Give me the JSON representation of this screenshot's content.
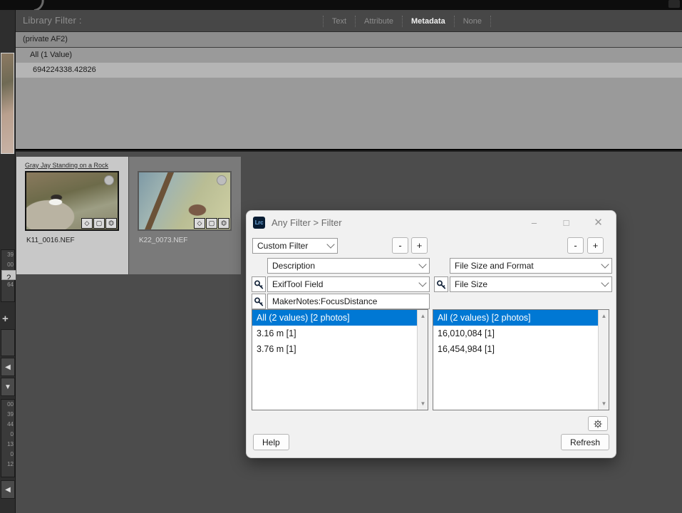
{
  "app": {
    "filter_bar": {
      "title": "Library Filter :",
      "tabs": [
        {
          "label": "Text",
          "active": false
        },
        {
          "label": "Attribute",
          "active": false
        },
        {
          "label": "Metadata",
          "active": true
        },
        {
          "label": "None",
          "active": false
        }
      ]
    },
    "metadata_panel": {
      "column_header": "(private AF2)",
      "rows": [
        {
          "label": "All (1 Value)",
          "type": "all"
        },
        {
          "label": "694224338.42826",
          "type": "value"
        }
      ]
    },
    "filmstrip": [
      {
        "title": "Gray Jay Standing on a Rock",
        "filename": "K11_0016.NEF",
        "selected": true,
        "badges": [
          "keyword-badge",
          "crop-badge",
          "develop-badge"
        ]
      },
      {
        "title": "",
        "filename": "K22_0073.NEF",
        "selected": false,
        "badges": [
          "keyword-badge",
          "crop-badge",
          "develop-badge"
        ]
      }
    ],
    "left_rail": {
      "numbers_top": [
        "39",
        "00",
        "2",
        "64"
      ],
      "numbers_top_selected_index": 2,
      "numbers_bottom": [
        "00",
        "39",
        "44",
        "0",
        "13",
        "0",
        "12"
      ],
      "add_label": "+"
    }
  },
  "dialog": {
    "app_icon_label": "Lrc",
    "title": "Any Filter > Filter",
    "window_controls": {
      "minimize": "–",
      "maximize": "□",
      "close": "✕"
    },
    "preset": {
      "value": "Custom Filter",
      "minus_label": "-",
      "plus_label": "+"
    },
    "columns": [
      {
        "category": "Description",
        "field": "ExifTool Field",
        "text_value": "MakerNotes:FocusDistance",
        "has_text_input": true,
        "minus_label": "-",
        "plus_label": "+",
        "list": [
          {
            "label": "All (2 values) [2 photos]",
            "selected": true
          },
          {
            "label": "3.16 m [1]",
            "selected": false
          },
          {
            "label": "3.76 m [1]",
            "selected": false
          }
        ]
      },
      {
        "category": "File Size and Format",
        "field": "File Size",
        "text_value": "",
        "has_text_input": false,
        "minus_label": "-",
        "plus_label": "+",
        "list": [
          {
            "label": "All (2 values) [2 photos]",
            "selected": true
          },
          {
            "label": "16,010,084 [1]",
            "selected": false
          },
          {
            "label": "16,454,984 [1]",
            "selected": false
          }
        ]
      }
    ],
    "help_label": "Help",
    "refresh_label": "Refresh",
    "gear_icon": "gear-icon"
  },
  "colors": {
    "accent_selection": "#0078d4",
    "dialog_bg": "#f1f1f1",
    "app_chrome": "#474747",
    "metadata_panel": "#9a9a9a",
    "grid_bg": "#4c4c4c"
  }
}
